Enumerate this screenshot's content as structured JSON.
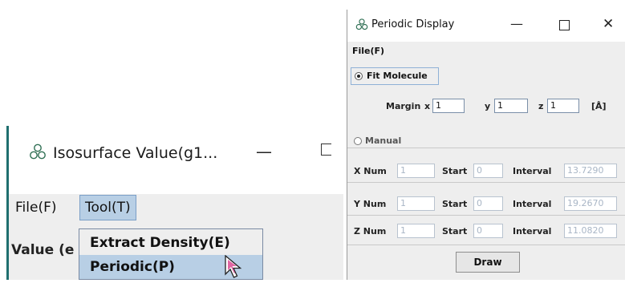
{
  "isosurface_window": {
    "title": "Isosurface Value(g1...",
    "minimize_glyph": "—",
    "menu": {
      "file": "File(F)",
      "tool": "Tool(T)"
    },
    "value_label": "Value (e",
    "tool_menu_items": [
      "Extract Density(E)",
      "Periodic(P)"
    ],
    "selected_item": "Periodic(P)"
  },
  "periodic_window": {
    "title": "Periodic Display",
    "window_controls": {
      "minimize": "—",
      "close": "✕"
    },
    "menu": {
      "file": "File(F)"
    },
    "fit_molecule": {
      "label": "Fit Molecule",
      "selected": true,
      "margin_label": "Margin",
      "x_label": "x",
      "x_value": "1",
      "y_label": "y",
      "y_value": "1",
      "z_label": "z",
      "z_value": "1",
      "unit": "[Å]"
    },
    "manual": {
      "label": "Manual",
      "selected": false,
      "rows": [
        {
          "num_label": "X Num",
          "num": "1",
          "start_label": "Start",
          "start": "0",
          "interval_label": "Interval",
          "interval": "13.7290"
        },
        {
          "num_label": "Y Num",
          "num": "1",
          "start_label": "Start",
          "start": "0",
          "interval_label": "Interval",
          "interval": "19.2670"
        },
        {
          "num_label": "Z Num",
          "num": "1",
          "start_label": "Start",
          "start": "0",
          "interval_label": "Interval",
          "interval": "11.0820"
        }
      ]
    },
    "draw_button": "Draw"
  },
  "colors": {
    "accent": "#1f6f6f",
    "selection": "#b8cfe5",
    "icon": "#2f6f54"
  },
  "icons": [
    "atom-icon",
    "cursor-pointer-icon"
  ]
}
